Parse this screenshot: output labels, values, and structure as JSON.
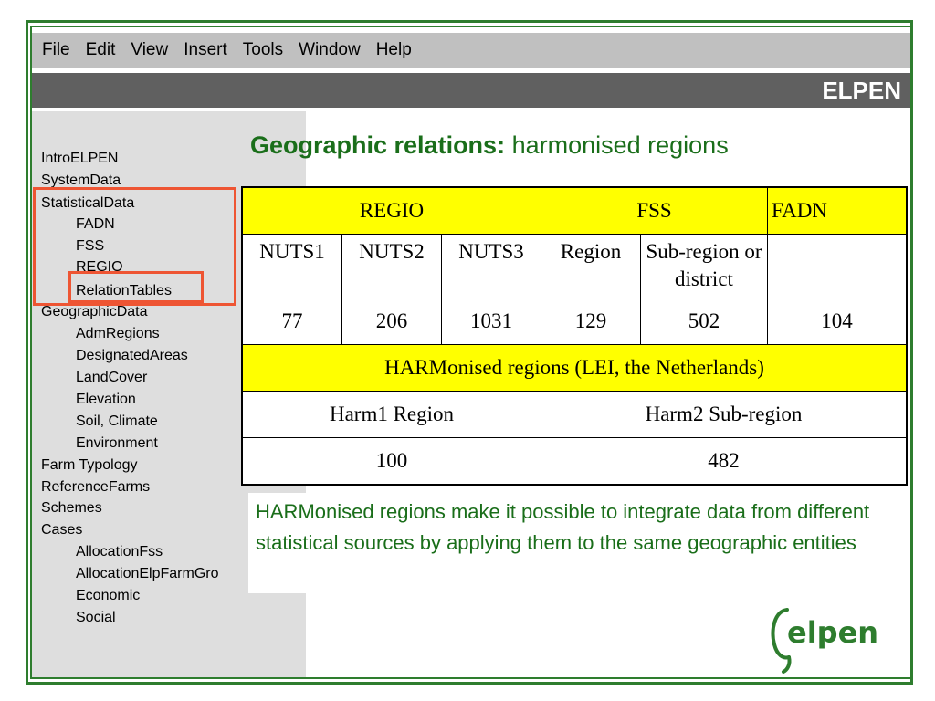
{
  "menu": [
    "File",
    "Edit",
    "View",
    "Insert",
    "Tools",
    "Window",
    "Help"
  ],
  "app_title": "ELPEN",
  "sidebar": {
    "items": [
      {
        "label": "IntroELPEN",
        "level": 0
      },
      {
        "label": "SystemData",
        "level": 0
      },
      {
        "label": "StatisticalData",
        "level": 0
      },
      {
        "label": "FADN",
        "level": 1
      },
      {
        "label": "FSS",
        "level": 1
      },
      {
        "label": "REGIO",
        "level": 1
      },
      {
        "label": "RelationTables",
        "level": 1
      },
      {
        "label": "GeographicData",
        "level": 0
      },
      {
        "label": "AdmRegions",
        "level": 1
      },
      {
        "label": "DesignatedAreas",
        "level": 1
      },
      {
        "label": "LandCover",
        "level": 1
      },
      {
        "label": "Elevation",
        "level": 1
      },
      {
        "label": "Soil, Climate",
        "level": 1
      },
      {
        "label": "Environment",
        "level": 1
      },
      {
        "label": "Farm Typology",
        "level": 0
      },
      {
        "label": "ReferenceFarms",
        "level": 0
      },
      {
        "label": "Schemes",
        "level": 0
      },
      {
        "label": "Cases",
        "level": 0
      },
      {
        "label": "AllocationFss",
        "level": 1
      },
      {
        "label": "AllocationElpFarmGro",
        "level": 1
      },
      {
        "label": "Economic",
        "level": 1
      },
      {
        "label": "Social",
        "level": 1
      }
    ],
    "highlight_color": "#ee5533"
  },
  "main": {
    "heading_bold": "Geographic relations:",
    "heading_rest": " harmonised regions",
    "table": {
      "group_headers": [
        "REGIO",
        "FSS",
        "FADN"
      ],
      "columns": [
        "NUTS1",
        "NUTS2",
        "NUTS3",
        "Region",
        "Sub-region or district",
        ""
      ],
      "counts": [
        "77",
        "206",
        "1031",
        "129",
        "502",
        "104"
      ],
      "harm_title": "HARMonised regions (LEI, the Netherlands)",
      "harm_columns": [
        "Harm1 Region",
        "Harm2 Sub-region"
      ],
      "harm_counts": [
        "100",
        "482"
      ]
    },
    "description": "HARMonised regions make it possible to integrate data from different statistical sources by applying them to the same geographic entities"
  },
  "logo_text": "elpen",
  "colors": {
    "frame": "#2e7d2e",
    "heading": "#1a6e1a",
    "header_yellow": "#ffff00",
    "titlebar": "#606060",
    "menubar": "#c0c0c0"
  }
}
